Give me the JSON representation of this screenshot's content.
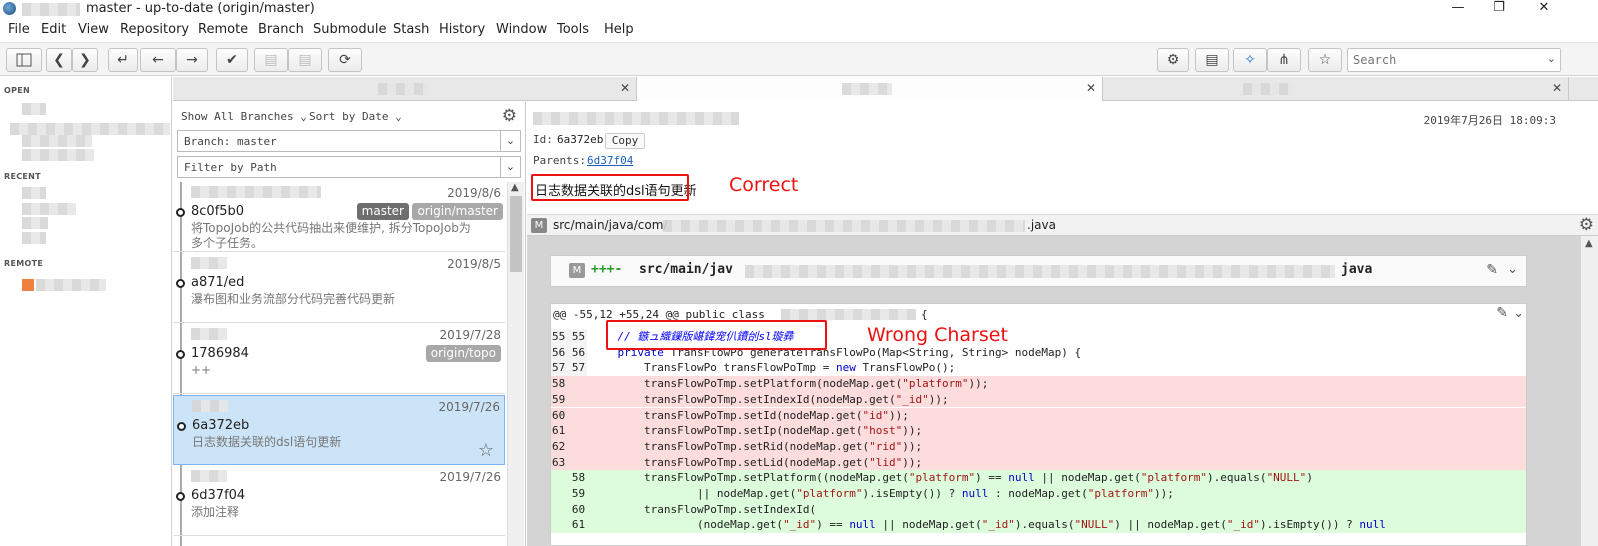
{
  "window": {
    "title": "master - up-to-date (origin/master)",
    "controls": {
      "minimize": "—",
      "maximize": "❐",
      "close": "✕"
    }
  },
  "menu": [
    "File",
    "Edit",
    "View",
    "Repository",
    "Remote",
    "Branch",
    "Submodule",
    "Stash",
    "History",
    "Window",
    "Tools",
    "Help"
  ],
  "search": {
    "placeholder": "Search"
  },
  "sidebar": {
    "open_label": "OPEN",
    "recent_label": "RECENT",
    "remote_label": "REMOTE"
  },
  "left_pane": {
    "branches_filter": "Show All Branches",
    "sort": "Sort by Date",
    "branch_field": "Branch: master",
    "path_filter": "Filter by Path"
  },
  "commits": [
    {
      "date": "2019/8/6",
      "hash": "8c0f5b0",
      "message": "将TopoJob的公共代码抽出来便维护, 拆分TopoJob为多个子任务。",
      "badges": [
        "master",
        "origin/master"
      ]
    },
    {
      "date": "2019/8/5",
      "hash": "a871/ed",
      "message": "瀑布图和业务流部分代码完善代码更新",
      "badges": []
    },
    {
      "date": "2019/7/28",
      "hash": "1786984",
      "message": "++",
      "badges": [
        "origin/topo"
      ]
    },
    {
      "date": "2019/7/26",
      "hash": "6a372eb",
      "message": "日志数据关联的dsl语句更新",
      "badges": [],
      "selected": true
    },
    {
      "date": "2019/7/26",
      "hash": "6d37f04",
      "message": "添加注释",
      "badges": []
    }
  ],
  "commit_detail": {
    "date": "2019年7月26日 18:09:3",
    "id_label": "Id:",
    "id": "6a372eb",
    "copy_label": "Copy",
    "parents_label": "Parents:",
    "parent": "6d37f04",
    "message": "日志数据关联的dsl语句更新",
    "annotation_correct": "Correct",
    "annotation_wrong": "Wrong Charset"
  },
  "file": {
    "path_prefix": "src/main/java/com/",
    "path_suffix": ".java",
    "diff_header_prefix": "src/main/jav",
    "diff_header_suffix": "java",
    "status_letter": "M",
    "plus_minus": "+++-"
  },
  "hunk": {
    "header": "@@ -55,12 +55,24 @@ public class",
    "header_end": "{",
    "lines": [
      {
        "old": "55",
        "new": "55",
        "type": "ctx",
        "text": "    // 鏃ュ織鏁版嵁鍏宠仈鐨刣sl璇彞"
      },
      {
        "old": "56",
        "new": "56",
        "type": "ctx",
        "text": "    private TransFlowPo generateTransFlowPo(Map<String, String> nodeMap) {"
      },
      {
        "old": "57",
        "new": "57",
        "type": "ctx",
        "text": "        TransFlowPo transFlowPoTmp = new TransFlowPo();"
      },
      {
        "old": "58",
        "new": "",
        "type": "del",
        "text": "        transFlowPoTmp.setPlatform(nodeMap.get(\"platform\"));"
      },
      {
        "old": "59",
        "new": "",
        "type": "del",
        "text": "        transFlowPoTmp.setIndexId(nodeMap.get(\"_id\"));"
      },
      {
        "old": "60",
        "new": "",
        "type": "del",
        "text": "        transFlowPoTmp.setId(nodeMap.get(\"id\"));"
      },
      {
        "old": "61",
        "new": "",
        "type": "del",
        "text": "        transFlowPoTmp.setIp(nodeMap.get(\"host\"));"
      },
      {
        "old": "62",
        "new": "",
        "type": "del",
        "text": "        transFlowPoTmp.setRid(nodeMap.get(\"rid\"));"
      },
      {
        "old": "63",
        "new": "",
        "type": "del",
        "text": "        transFlowPoTmp.setLid(nodeMap.get(\"lid\"));"
      },
      {
        "old": "",
        "new": "58",
        "type": "add",
        "text": "        transFlowPoTmp.setPlatform((nodeMap.get(\"platform\") == null || nodeMap.get(\"platform\").equals(\"NULL\")"
      },
      {
        "old": "",
        "new": "59",
        "type": "add",
        "text": "                || nodeMap.get(\"platform\").isEmpty()) ? null : nodeMap.get(\"platform\"));"
      },
      {
        "old": "",
        "new": "60",
        "type": "add",
        "text": "        transFlowPoTmp.setIndexId("
      },
      {
        "old": "",
        "new": "61",
        "type": "add",
        "text": "                (nodeMap.get(\"_id\") == null || nodeMap.get(\"_id\").equals(\"NULL\") || nodeMap.get(\"_id\").isEmpty()) ? null"
      }
    ]
  },
  "colors": {
    "accent": "#2a7dd1",
    "annotation": "#ee1111",
    "del_bg": "#fcdcdc",
    "add_bg": "#dcfcdc",
    "badge_master": "#6e6e6e",
    "badge_origin": "#a8a8a8"
  }
}
